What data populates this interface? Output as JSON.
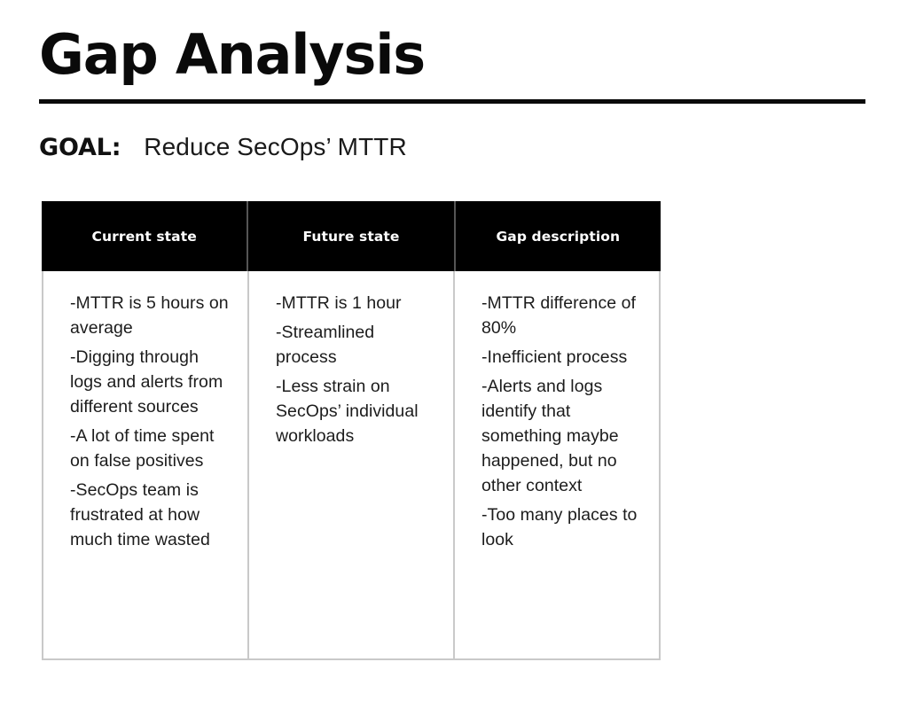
{
  "slide": {
    "title": "Gap Analysis",
    "goal_label": "GOAL:",
    "goal_text": "Reduce SecOps’ MTTR",
    "accent_color": "#000000",
    "border_color": "#c9c9c9",
    "background_color": "#ffffff"
  },
  "table": {
    "headers": [
      {
        "label": "Current state"
      },
      {
        "label": "Future state"
      },
      {
        "label": "Gap description"
      }
    ],
    "columns": [
      {
        "bullets": [
          "-MTTR is 5 hours on average",
          "-Digging through logs and alerts from different sources",
          "-A lot of time spent on false positives",
          "-SecOps team is frustrated at how much time wasted"
        ]
      },
      {
        "bullets": [
          "-MTTR is 1 hour",
          "-Streamlined process",
          "-Less strain on SecOps’ individual workloads"
        ]
      },
      {
        "bullets": [
          "-MTTR difference of 80%",
          "-Inefficient process",
          "-Alerts and logs identify that something maybe happened, but no other context",
          "-Too many places to look"
        ]
      }
    ]
  }
}
